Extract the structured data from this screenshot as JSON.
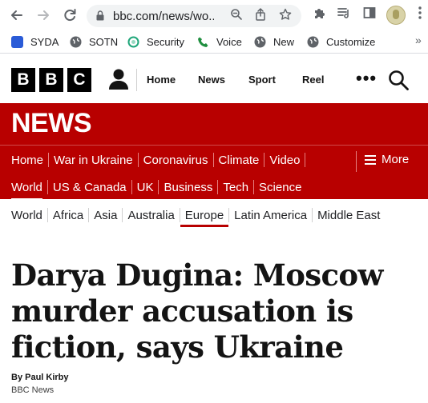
{
  "browser": {
    "url": "bbc.com/news/wo...",
    "icons": {
      "back": "arrow-left-icon",
      "forward": "arrow-right-icon",
      "reload": "reload-icon",
      "lock": "lock-icon",
      "zoom": "zoom-icon",
      "share": "share-icon",
      "star": "star-icon",
      "extensions": "puzzle-icon",
      "reading_list": "reading-list-icon",
      "side_panel": "side-panel-icon",
      "menu": "kebab-menu-icon"
    }
  },
  "bookmarks": [
    {
      "label": "SYDA",
      "icon": "syda-favicon",
      "color": "#2a5bd7"
    },
    {
      "label": "SOTN",
      "icon": "globe-icon",
      "color": "#5f6368"
    },
    {
      "label": "Security",
      "icon": "security-favicon",
      "color": "#1fa67a"
    },
    {
      "label": "Voice",
      "icon": "phone-icon",
      "color": "#1e8e3e"
    },
    {
      "label": "New",
      "icon": "globe-icon",
      "color": "#5f6368"
    },
    {
      "label": "Customize",
      "icon": "globe-icon",
      "color": "#5f6368"
    }
  ],
  "bookmarks_overflow": "»",
  "masthead": {
    "logo": [
      "B",
      "B",
      "C"
    ],
    "links": [
      "Home",
      "News",
      "Sport",
      "Reel"
    ],
    "more": "•••"
  },
  "news": {
    "title": "NEWS",
    "brand_color": "#b80000",
    "primary_nav": [
      "Home",
      "War in Ukraine",
      "Coronavirus",
      "Climate",
      "Video"
    ],
    "more_label": "More",
    "secondary_nav": [
      "World",
      "US & Canada",
      "UK",
      "Business",
      "Tech",
      "Science"
    ],
    "secondary_active": "World",
    "sub_nav": [
      "World",
      "Africa",
      "Asia",
      "Australia",
      "Europe",
      "Latin America",
      "Middle East"
    ],
    "sub_active": "Europe"
  },
  "article": {
    "headline": "Darya Dugina: Moscow murder accusation is fiction, says Ukraine",
    "author": "By Paul Kirby",
    "organisation": "BBC News"
  }
}
